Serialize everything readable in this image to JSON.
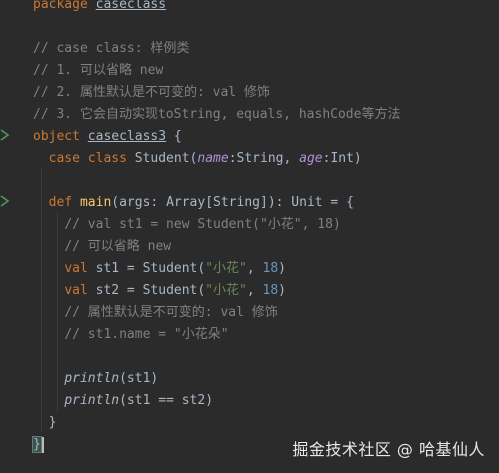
{
  "editor": {
    "lines": [
      {
        "id": "l1",
        "tokens": [
          {
            "t": "kw",
            "v": "package "
          },
          {
            "t": "ul",
            "v": "caseclass"
          }
        ]
      },
      {
        "id": "l2",
        "tokens": []
      },
      {
        "id": "l3",
        "tokens": [
          {
            "t": "cmt",
            "v": "// case class: 样例类"
          }
        ]
      },
      {
        "id": "l4",
        "tokens": [
          {
            "t": "cmt",
            "v": "// 1. 可以省略 new"
          }
        ]
      },
      {
        "id": "l5",
        "tokens": [
          {
            "t": "cmt",
            "v": "// 2. 属性默认是不可变的: val 修饰"
          }
        ]
      },
      {
        "id": "l6",
        "tokens": [
          {
            "t": "cmt",
            "v": "// 3. 它会自动实现toString, equals, hashCode等方法"
          }
        ]
      },
      {
        "id": "l7",
        "tokens": [
          {
            "t": "kw",
            "v": "object "
          },
          {
            "t": "ul",
            "v": "caseclass3"
          },
          {
            "t": "plain",
            "v": " {"
          }
        ]
      },
      {
        "id": "l8",
        "tokens": [
          {
            "t": "plain",
            "v": "  "
          },
          {
            "t": "kw",
            "v": "case class "
          },
          {
            "t": "plain",
            "v": "Student("
          },
          {
            "t": "param",
            "v": "name"
          },
          {
            "t": "plain",
            "v": ":String, "
          },
          {
            "t": "param",
            "v": "age"
          },
          {
            "t": "plain",
            "v": ":Int)"
          }
        ]
      },
      {
        "id": "l9",
        "tokens": []
      },
      {
        "id": "l10",
        "tokens": [
          {
            "t": "plain",
            "v": "  "
          },
          {
            "t": "kw",
            "v": "def "
          },
          {
            "t": "fn",
            "v": "main"
          },
          {
            "t": "plain",
            "v": "(args: Array[String]): Unit = {"
          }
        ]
      },
      {
        "id": "l11",
        "tokens": [
          {
            "t": "plain",
            "v": "    "
          },
          {
            "t": "cmt",
            "v": "// val st1 = new Student(\"小花\", 18)"
          }
        ]
      },
      {
        "id": "l12",
        "tokens": [
          {
            "t": "plain",
            "v": "    "
          },
          {
            "t": "cmt",
            "v": "// 可以省略 new"
          }
        ]
      },
      {
        "id": "l13",
        "tokens": [
          {
            "t": "plain",
            "v": "    "
          },
          {
            "t": "kw",
            "v": "val "
          },
          {
            "t": "plain",
            "v": "st1 = Student("
          },
          {
            "t": "str",
            "v": "\"小花\""
          },
          {
            "t": "plain",
            "v": ", "
          },
          {
            "t": "num",
            "v": "18"
          },
          {
            "t": "plain",
            "v": ")"
          }
        ]
      },
      {
        "id": "l14",
        "tokens": [
          {
            "t": "plain",
            "v": "    "
          },
          {
            "t": "kw",
            "v": "val "
          },
          {
            "t": "plain",
            "v": "st2 = Student("
          },
          {
            "t": "str",
            "v": "\"小花\""
          },
          {
            "t": "plain",
            "v": ", "
          },
          {
            "t": "num",
            "v": "18"
          },
          {
            "t": "plain",
            "v": ")"
          }
        ]
      },
      {
        "id": "l15",
        "tokens": [
          {
            "t": "plain",
            "v": "    "
          },
          {
            "t": "cmt",
            "v": "// 属性默认是不可变的: val 修饰"
          }
        ]
      },
      {
        "id": "l16",
        "tokens": [
          {
            "t": "plain",
            "v": "    "
          },
          {
            "t": "cmt",
            "v": "// st1.name = \"小花朵\""
          }
        ]
      },
      {
        "id": "l17",
        "tokens": []
      },
      {
        "id": "l18",
        "tokens": [
          {
            "t": "plain",
            "v": "    "
          },
          {
            "t": "ital",
            "v": "println"
          },
          {
            "t": "plain",
            "v": "(st1)"
          }
        ]
      },
      {
        "id": "l19",
        "tokens": [
          {
            "t": "plain",
            "v": "    "
          },
          {
            "t": "ital",
            "v": "println"
          },
          {
            "t": "plain",
            "v": "(st1 == st2)"
          }
        ]
      },
      {
        "id": "l20",
        "tokens": [
          {
            "t": "plain",
            "v": "  }"
          }
        ]
      },
      {
        "id": "l21",
        "tokens": [
          {
            "t": "brace",
            "v": "}"
          }
        ]
      }
    ]
  },
  "watermark": "掘金技术社区 @ 哈基仙人",
  "colors": {
    "background": "#2b2b2b",
    "keyword": "#cc7832",
    "comment": "#808080",
    "string": "#6a8759",
    "number": "#6897bb",
    "param": "#b38fd6",
    "function": "#ffc66d",
    "text": "#a9b7c6",
    "run_marker": "#499c54"
  },
  "icons": {
    "run_markers": [
      "run-gutter-icon",
      "run-gutter-icon"
    ]
  }
}
